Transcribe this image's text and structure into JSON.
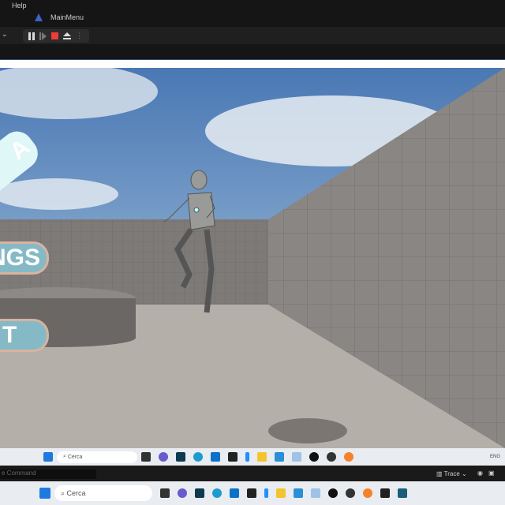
{
  "editor": {
    "menu": [
      "Help"
    ],
    "tab": "MainMenu",
    "toolbar": {
      "buttons": [
        "pause",
        "skip-frame",
        "stop",
        "eject",
        "more"
      ],
      "stop_color": "#e53935"
    }
  },
  "game_menu": {
    "buttons": [
      {
        "label": "A"
      },
      {
        "label": "NGS"
      },
      {
        "label": "T"
      }
    ],
    "colors": {
      "button": "#86b9c6",
      "border": "#d8b3a0",
      "top": "#dff7f7"
    }
  },
  "inner_taskbar": {
    "search_placeholder": "Cerca",
    "tray_lang": "ENG"
  },
  "command_bar": {
    "placeholder": "e Command",
    "trace_label": "Trace"
  },
  "outer_taskbar": {
    "search_placeholder": "Cerca"
  }
}
